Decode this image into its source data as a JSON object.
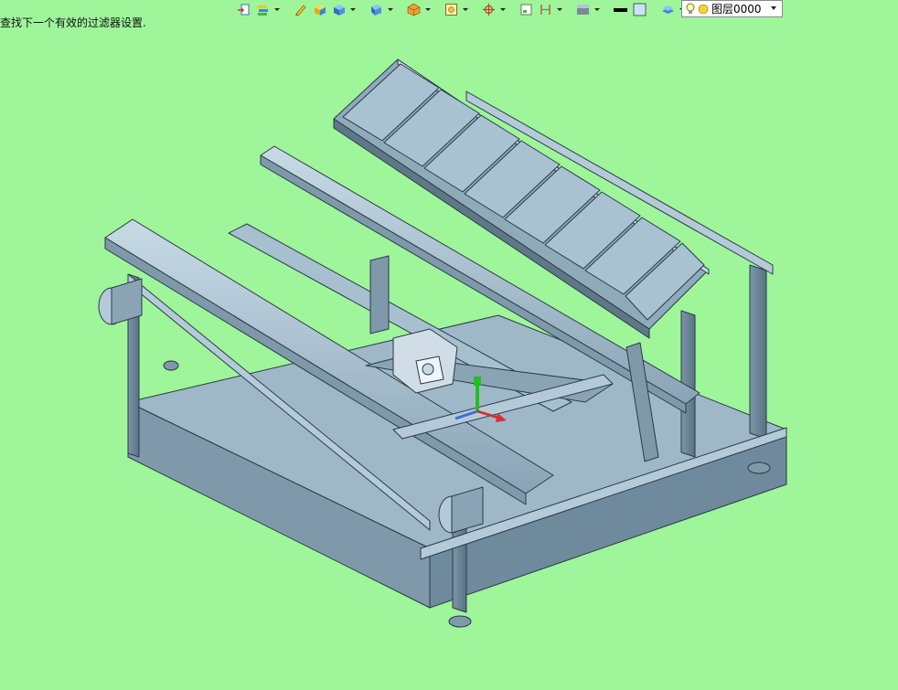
{
  "status": {
    "message": "查找下一个有效的过滤器设置."
  },
  "toolbar": {
    "icons": [
      "insert-icon",
      "layer-properties-icon",
      "pencil-icon",
      "yellow-box-icon",
      "blue-box-icon",
      "solid-view-icon",
      "render-style-icon",
      "view-frame-icon",
      "crosshair-icon",
      "clip-icon",
      "dimension-icon",
      "shade-mode-icon",
      "black-line-icon",
      "color-square-icon",
      "layers-stack-icon"
    ],
    "colors": {
      "yellow": "#f2c230",
      "blue": "#3a86d8",
      "red": "#d83030",
      "orange": "#f0a030"
    }
  },
  "layer": {
    "name": "图层0000"
  },
  "viewport": {
    "background": "#9ef59a",
    "model_color": "#9fb8c8",
    "model_dark": "#6f8a9c",
    "model_light": "#c7dae6"
  }
}
